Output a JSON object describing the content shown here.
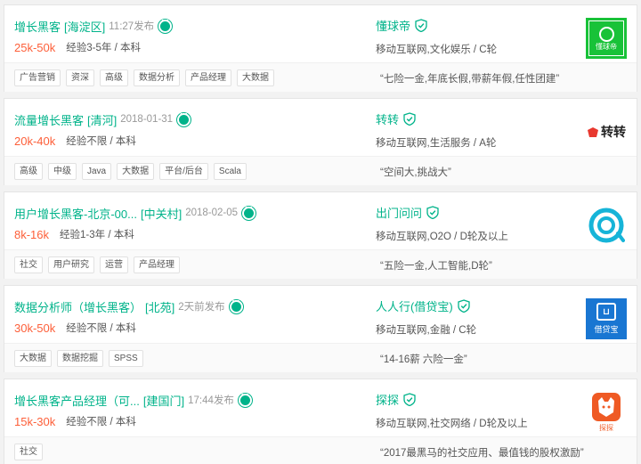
{
  "colors": {
    "accent": "#00b38a",
    "salary": "#fd5f39",
    "text": "#555555",
    "muted": "#999999"
  },
  "jobs": [
    {
      "title": "增长黑客",
      "area": "[海淀区]",
      "time": "11:27发布",
      "salary": "25k-50k",
      "requirement": "经验3-5年 / 本科",
      "tags": [
        "广告营销",
        "资深",
        "高级",
        "数据分析",
        "产品经理",
        "大数据"
      ],
      "company": "懂球帝",
      "industry": "移动互联网,文化娱乐 / C轮",
      "welfare": "“七险一金,年底长假,带薪年假,任性团建”",
      "logo_text": "懂球帝",
      "logo_icon": "soccer-logo"
    },
    {
      "title": "流量增长黑客",
      "area": "[清河]",
      "time": "2018-01-31",
      "salary": "20k-40k",
      "requirement": "经验不限 / 本科",
      "tags": [
        "高级",
        "中级",
        "Java",
        "大数据",
        "平台/后台",
        "Scala"
      ],
      "company": "转转",
      "industry": "移动互联网,生活服务 / A轮",
      "welfare": "“空间大,挑战大”",
      "logo_text": "转转",
      "logo_icon": "zhuanzhuan-logo"
    },
    {
      "title": "用户增长黑客-北京-00...",
      "area": "[中关村]",
      "time": "2018-02-05",
      "salary": "8k-16k",
      "requirement": "经验1-3年 / 本科",
      "tags": [
        "社交",
        "用户研究",
        "运营",
        "产品经理"
      ],
      "company": "出门问问",
      "industry": "移动互联网,O2O / D轮及以上",
      "welfare": "“五险一金,人工智能,D轮”",
      "logo_text": "",
      "logo_icon": "mobvoi-logo"
    },
    {
      "title": "数据分析师（增长黑客）",
      "area": "[北苑]",
      "time": "2天前发布",
      "salary": "30k-50k",
      "requirement": "经验不限 / 本科",
      "tags": [
        "大数据",
        "数据挖掘",
        "SPSS"
      ],
      "company": "人人行(借贷宝)",
      "industry": "移动互联网,金融 / C轮",
      "welfare": "“14-16薪 六险一金”",
      "logo_text": "借贷宝",
      "logo_icon": "jiedaibao-logo"
    },
    {
      "title": "增长黑客产品经理（可...",
      "area": "[建国门]",
      "time": "17:44发布",
      "salary": "15k-30k",
      "requirement": "经验不限 / 本科",
      "tags": [
        "社交"
      ],
      "company": "探探",
      "industry": "移动互联网,社交网络 / D轮及以上",
      "welfare": "“2017最黑马的社交应用、最值钱的股权激励”",
      "logo_text": "探探",
      "logo_icon": "tantan-logo"
    }
  ]
}
